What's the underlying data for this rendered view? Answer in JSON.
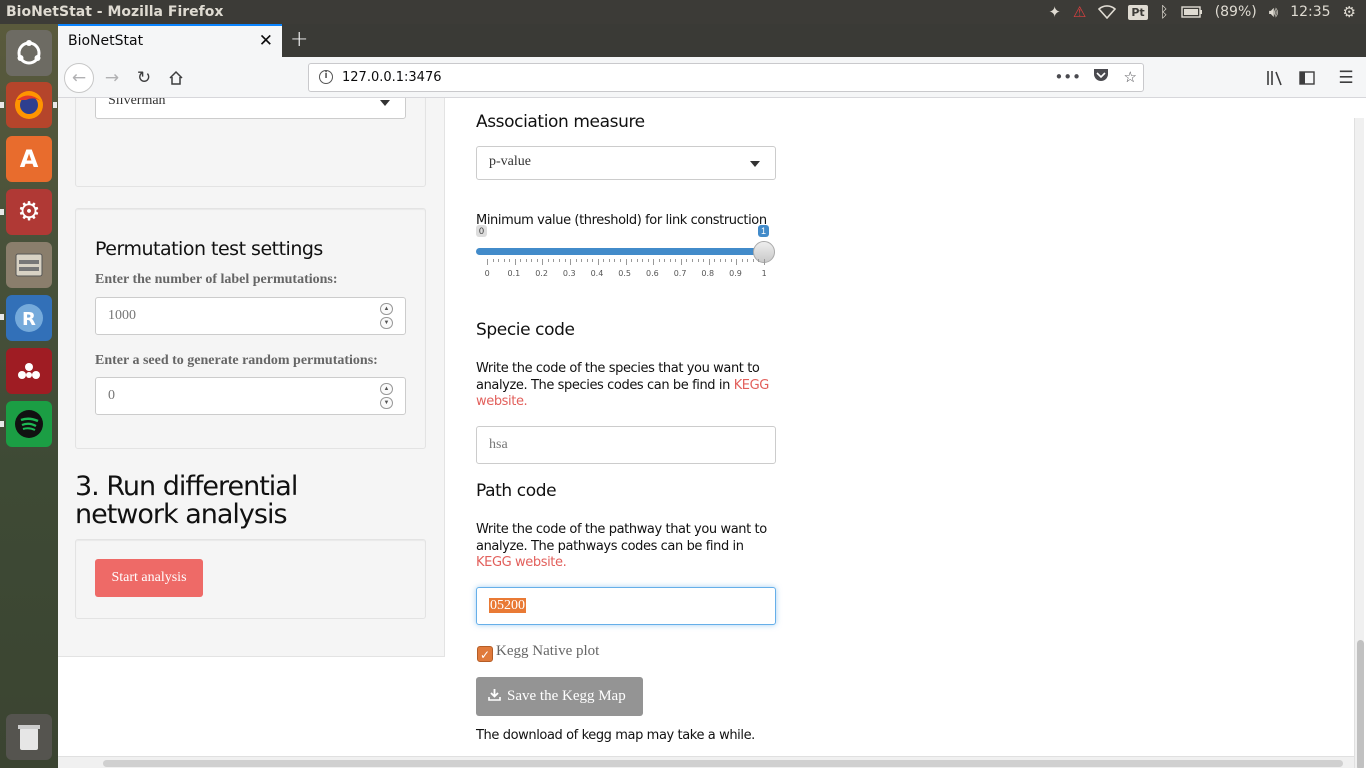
{
  "os": {
    "window_title": "BioNetStat - Mozilla Firefox",
    "battery": "(89%)",
    "clock": "12:35",
    "tray_pt": "Pt"
  },
  "launcher": {
    "items": [
      "ubuntu-dash",
      "firefox",
      "software-center",
      "system-settings",
      "file-manager",
      "rstudio",
      "mendeley",
      "spotify",
      "trash"
    ]
  },
  "browser": {
    "tab_title": "BioNetStat",
    "url": "127.0.0.1:3476"
  },
  "sidebar": {
    "density_select_value": "Silverman",
    "perm_title": "Permutation test settings",
    "perm_label": "Enter the number of label permutations:",
    "perm_value": "1000",
    "seed_label": "Enter a seed to generate random permutations:",
    "seed_value": "0",
    "run_title": "3. Run differential network analysis",
    "start_button": "Start analysis"
  },
  "main": {
    "assoc_title": "Association measure",
    "assoc_select_value": "p-value",
    "threshold_label": "Minimum value (threshold) for link construction",
    "slider": {
      "min_label": "0",
      "value_label": "1",
      "value": 1,
      "ticks": [
        "0",
        "0.1",
        "0.2",
        "0.3",
        "0.4",
        "0.5",
        "0.6",
        "0.7",
        "0.8",
        "0.9",
        "1"
      ]
    },
    "specie_title": "Specie code",
    "specie_text": "Write the code of the species that you want to analyze. The species codes can be find in ",
    "specie_link": "KEGG website.",
    "specie_placeholder": "hsa",
    "path_title": "Path code",
    "path_text": "Write the code of the pathway that you want to analyze. The pathways codes can be find in ",
    "path_link": "KEGG website.",
    "path_value": "05200",
    "kegg_native_label": "Kegg Native plot",
    "kegg_native_checked": true,
    "save_button": "Save the Kegg Map",
    "download_note": "The download of kegg map may take a while."
  },
  "colors": {
    "accent_danger": "#ee6a67",
    "link": "#e2605c",
    "slider": "#428bca",
    "checkbox": "#e07a3b"
  }
}
